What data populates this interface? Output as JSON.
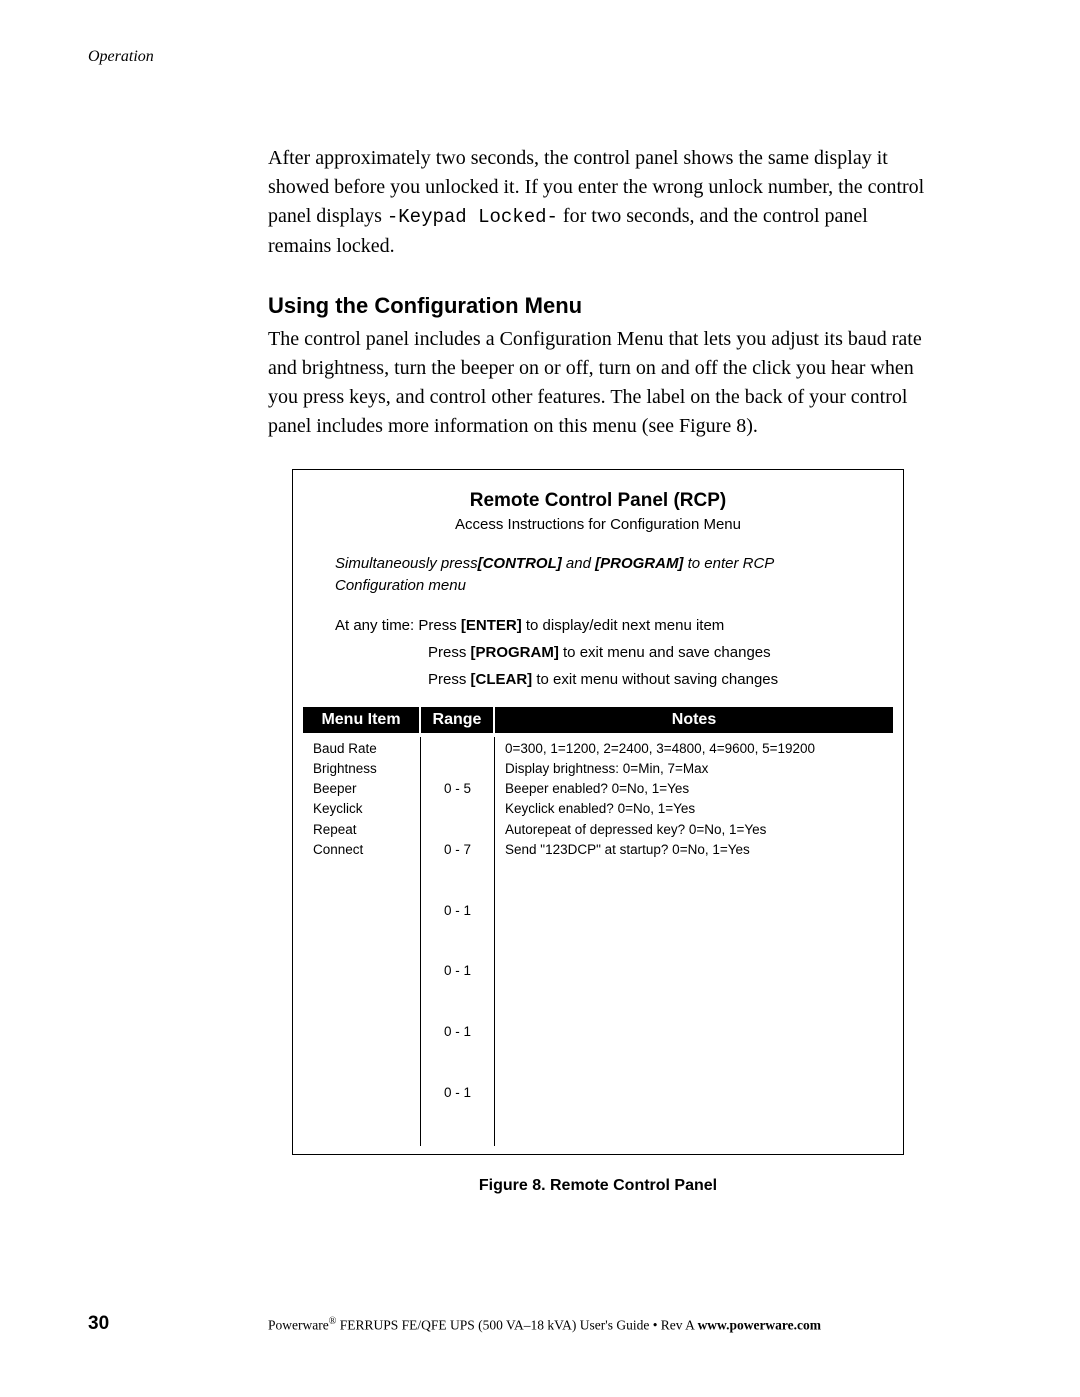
{
  "header": {
    "section": "Operation"
  },
  "body": {
    "para1_a": "After approximately two seconds, the control panel shows the same display it showed before you unlocked it. If you enter the wrong unlock number, the control panel displays ",
    "para1_mono": "-Keypad Locked-",
    "para1_b": " for two seconds, and the control panel remains locked.",
    "heading": "Using the Configuration Menu",
    "para2": "The control panel includes a Configuration Menu that lets you adjust its baud rate and brightness, turn the beeper on or off, turn on and off the click you hear when you press keys, and control other features. The label on the back of your control panel includes more information on this menu (see Figure 8)."
  },
  "figure": {
    "title": "Remote Control Panel (RCP)",
    "subtitle": "Access Instructions for Configuration Menu",
    "instr_pre": "Simultaneously press",
    "instr_b1": "[CONTROL]",
    "instr_mid": "  and ",
    "instr_b2": "[PROGRAM]",
    "instr_post": " to enter RCP Configuration menu",
    "any_pre": "At any time: Press ",
    "any_b1": "[ENTER]",
    "any_post1": " to display/edit next menu item",
    "any_l2a": "Press ",
    "any_b2": "[PROGRAM]",
    "any_l2b": " to exit menu and save changes",
    "any_l3a": "Press ",
    "any_b3": "[CLEAR]",
    "any_l3b": " to exit menu without saving changes",
    "th_item": "Menu Item",
    "th_range": "Range",
    "th_notes": "Notes",
    "rows": [
      {
        "item": "Baud Rate",
        "range": "0 - 5",
        "notes": "0=300, 1=1200, 2=2400, 3=4800, 4=9600, 5=19200"
      },
      {
        "item": "Brightness",
        "range": "0 - 7",
        "notes": "Display brightness: 0=Min, 7=Max"
      },
      {
        "item": "Beeper",
        "range": "0 - 1",
        "notes": "Beeper enabled? 0=No, 1=Yes"
      },
      {
        "item": "Keyclick",
        "range": "0 - 1",
        "notes": "Keyclick enabled? 0=No, 1=Yes"
      },
      {
        "item": "Repeat",
        "range": "0 - 1",
        "notes": "Autorepeat of depressed key? 0=No, 1=Yes"
      },
      {
        "item": "Connect",
        "range": "0 - 1",
        "notes": "Send \"123DCP\" at startup? 0=No, 1=Yes"
      }
    ],
    "caption": "Figure 8. Remote Control Panel"
  },
  "footer": {
    "page": "30",
    "text_a": "Powerware",
    "reg": "®",
    "text_b": " FERRUPS FE/QFE UPS (500 VA–18 kVA) User's Guide  •  Rev A ",
    "url": "www.powerware.com"
  }
}
